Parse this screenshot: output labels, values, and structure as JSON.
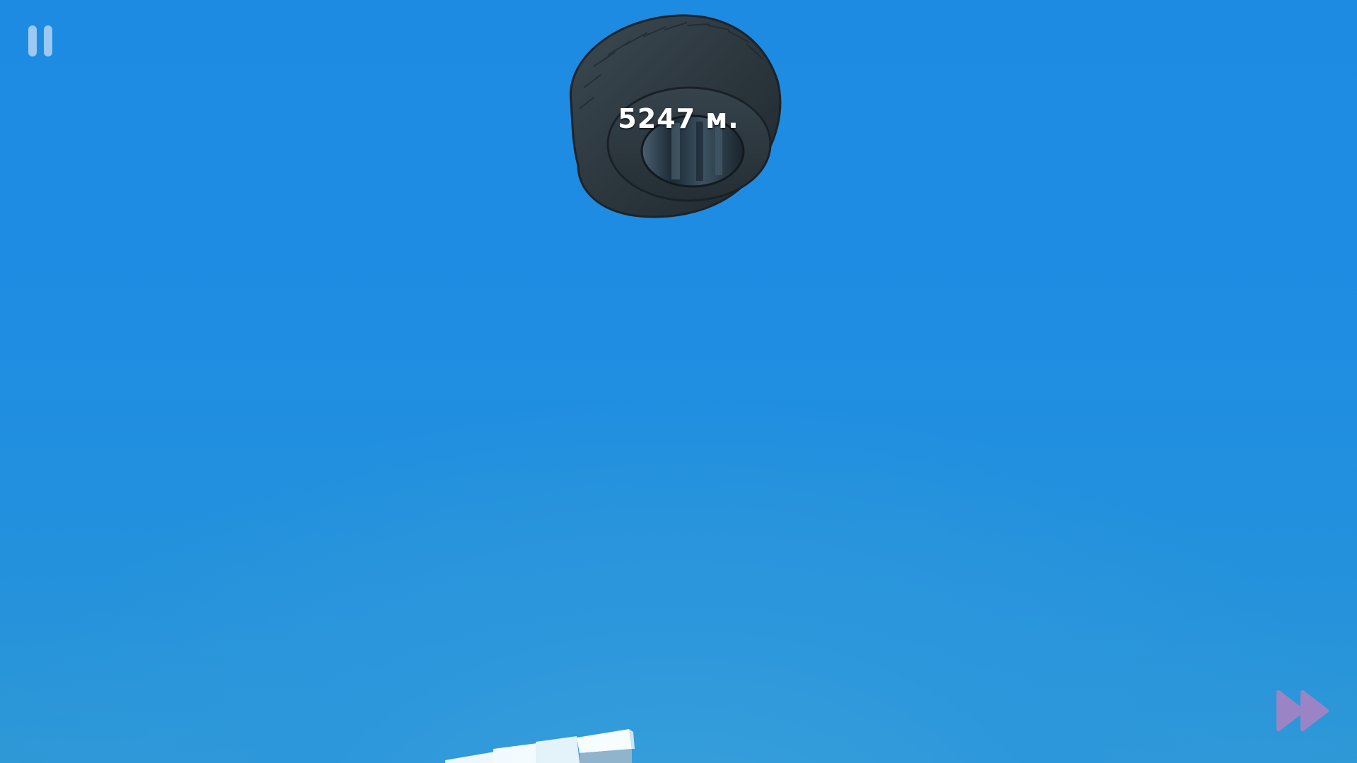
{
  "hud": {
    "distance_text": "5247 м.",
    "pause_icon": "pause-icon",
    "fast_forward_icon": "fast-forward-icon"
  },
  "colors": {
    "sky_top": "#1d8be2",
    "sky_bottom": "#35a0d8",
    "pause": "#9cc8f3",
    "fast_forward": "#9b84c6",
    "tire": "#2e3a42",
    "distance_text": "#ffffff"
  }
}
